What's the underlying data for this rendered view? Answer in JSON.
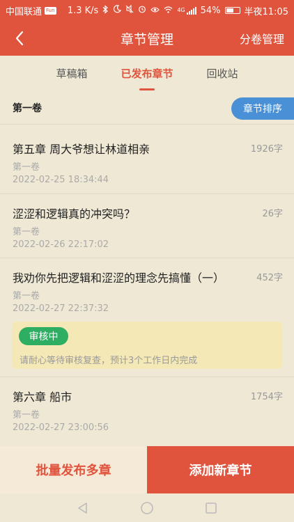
{
  "status_bar": {
    "carrier": "中国联通",
    "sms_badge": "Fun",
    "speed": "1.3 K/s",
    "network": "4G",
    "battery": "54%",
    "battery_level": 0.54,
    "time": "半夜11:05"
  },
  "header": {
    "title": "章节管理",
    "right_action": "分卷管理"
  },
  "tabs": [
    {
      "label": "草稿箱",
      "active": false
    },
    {
      "label": "已发布章节",
      "active": true
    },
    {
      "label": "回收站",
      "active": false
    }
  ],
  "volume": {
    "label": "第一卷",
    "sort_button": "章节排序"
  },
  "chapters": [
    {
      "title": "第五章  周大爷想让林道相亲",
      "count": "1926字",
      "volume": "第一卷",
      "date": "2022-02-25 18:34:44"
    },
    {
      "title": "涩涩和逻辑真的冲突吗？",
      "count": "26字",
      "volume": "第一卷",
      "date": "2022-02-26 22:17:02"
    },
    {
      "title": "我劝你先把逻辑和涩涩的理念先搞懂（一）",
      "count": "452字",
      "volume": "第一卷",
      "date": "2022-02-27 22:37:32"
    },
    {
      "title": "第六章  船市",
      "count": "1754字",
      "volume": "第一卷",
      "date": "2022-02-27 23:00:56"
    }
  ],
  "review": {
    "badge": "审核中",
    "message": "请耐心等待审核复查，预计3个工作日内完成"
  },
  "bottom_bar": {
    "batch_publish": "批量发布多章",
    "add_chapter": "添加新章节"
  },
  "colors": {
    "accent": "#e0533c",
    "sort_button": "#4a90d6",
    "review_badge": "#2eae63",
    "background": "#efe8d5"
  },
  "icons": {
    "back": "back-arrow-icon",
    "nav_back": "triangle-back-icon",
    "nav_home": "circle-home-icon",
    "nav_recent": "square-recent-icon"
  }
}
